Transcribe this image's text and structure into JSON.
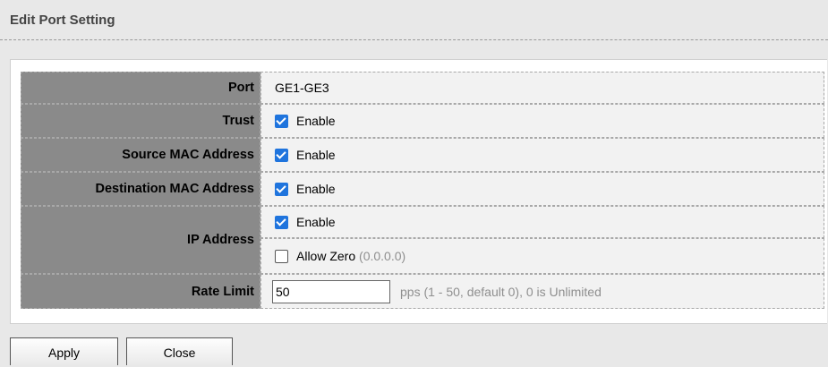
{
  "page": {
    "title": "Edit Port Setting"
  },
  "form": {
    "port": {
      "label": "Port",
      "value": "GE1-GE3"
    },
    "trust": {
      "label": "Trust",
      "option": "Enable",
      "checked": true
    },
    "source_mac": {
      "label": "Source MAC Address",
      "option": "Enable",
      "checked": true
    },
    "destination_mac": {
      "label": "Destination MAC Address",
      "option": "Enable",
      "checked": true
    },
    "ip_address": {
      "label": "IP Address",
      "enable": {
        "option": "Enable",
        "checked": true
      },
      "allow_zero": {
        "option": "Allow Zero",
        "note": "(0.0.0.0)",
        "checked": false
      }
    },
    "rate_limit": {
      "label": "Rate Limit",
      "value": "50",
      "hint": "pps (1 - 50, default 0), 0 is Unlimited"
    }
  },
  "buttons": {
    "apply": "Apply",
    "close": "Close"
  },
  "colors": {
    "label_bg": "#8a8a8a",
    "value_bg": "#f2f2f2",
    "checkbox": "#1f74dd"
  }
}
